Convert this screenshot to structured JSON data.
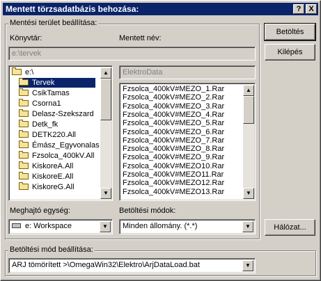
{
  "title": "Mentett törzsadatbázis behozása:",
  "title_buttons": {
    "help": "?",
    "close": "X"
  },
  "save_group": {
    "legend": "Mentési terület beállítása:",
    "directory_label": "Könyvtár:",
    "directory_value": "e:\\tervek",
    "saved_name_label": "Mentett név:",
    "saved_name_value": "",
    "folders": [
      {
        "name": "e:\\",
        "open": true,
        "selected": false
      },
      {
        "name": "Tervek",
        "open": true,
        "selected": true
      },
      {
        "name": "CsikTamas",
        "open": false,
        "selected": false
      },
      {
        "name": "Csorna1",
        "open": false,
        "selected": false
      },
      {
        "name": "Delasz-Szekszard",
        "open": false,
        "selected": false
      },
      {
        "name": "Detk_fk",
        "open": false,
        "selected": false
      },
      {
        "name": "DETK220.All",
        "open": false,
        "selected": false
      },
      {
        "name": "Émász_Egyvonalas",
        "open": false,
        "selected": false
      },
      {
        "name": "Fzsolca_400kV.All",
        "open": false,
        "selected": false
      },
      {
        "name": "KiskoreA.All",
        "open": false,
        "selected": false
      },
      {
        "name": "KiskoreE.All",
        "open": false,
        "selected": false
      },
      {
        "name": "KiskoreG.All",
        "open": false,
        "selected": false
      }
    ],
    "filename_field": "ElektroData",
    "files": [
      "Fzsolca_400kV#MEZO_1.Rar",
      "Fzsolca_400kV#MEZO_2.Rar",
      "Fzsolca_400kV#MEZO_3.Rar",
      "Fzsolca_400kV#MEZO_4.Rar",
      "Fzsolca_400kV#MEZO_5.Rar",
      "Fzsolca_400kV#MEZO_6.Rar",
      "Fzsolca_400kV#MEZO_7.Rar",
      "Fzsolca_400kV#MEZO_8.Rar",
      "Fzsolca_400kV#MEZO_9.Rar",
      "Fzsolca_400kV#MEZO10.Rar",
      "Fzsolca_400kV#MEZO11.Rar",
      "Fzsolca_400kV#MEZO12.Rar",
      "Fzsolca_400kV#MEZO13.Rar"
    ],
    "drive_label": "Meghajtó egység:",
    "drive_value": "e: Workspace",
    "load_mode_label": "Betöltési módok:",
    "load_mode_value": "Minden állomány. (*.*)"
  },
  "buttons": {
    "load": "Betöltés",
    "exit": "Kilépés",
    "network": "Hálózat..."
  },
  "load_group": {
    "legend": "Betöltési mód beállítása:",
    "value": "ARJ tömörített >\\OmegaWin32\\Elektro\\ArjDataLoad.bat"
  },
  "arrows": {
    "up": "▲",
    "down": "▼"
  }
}
